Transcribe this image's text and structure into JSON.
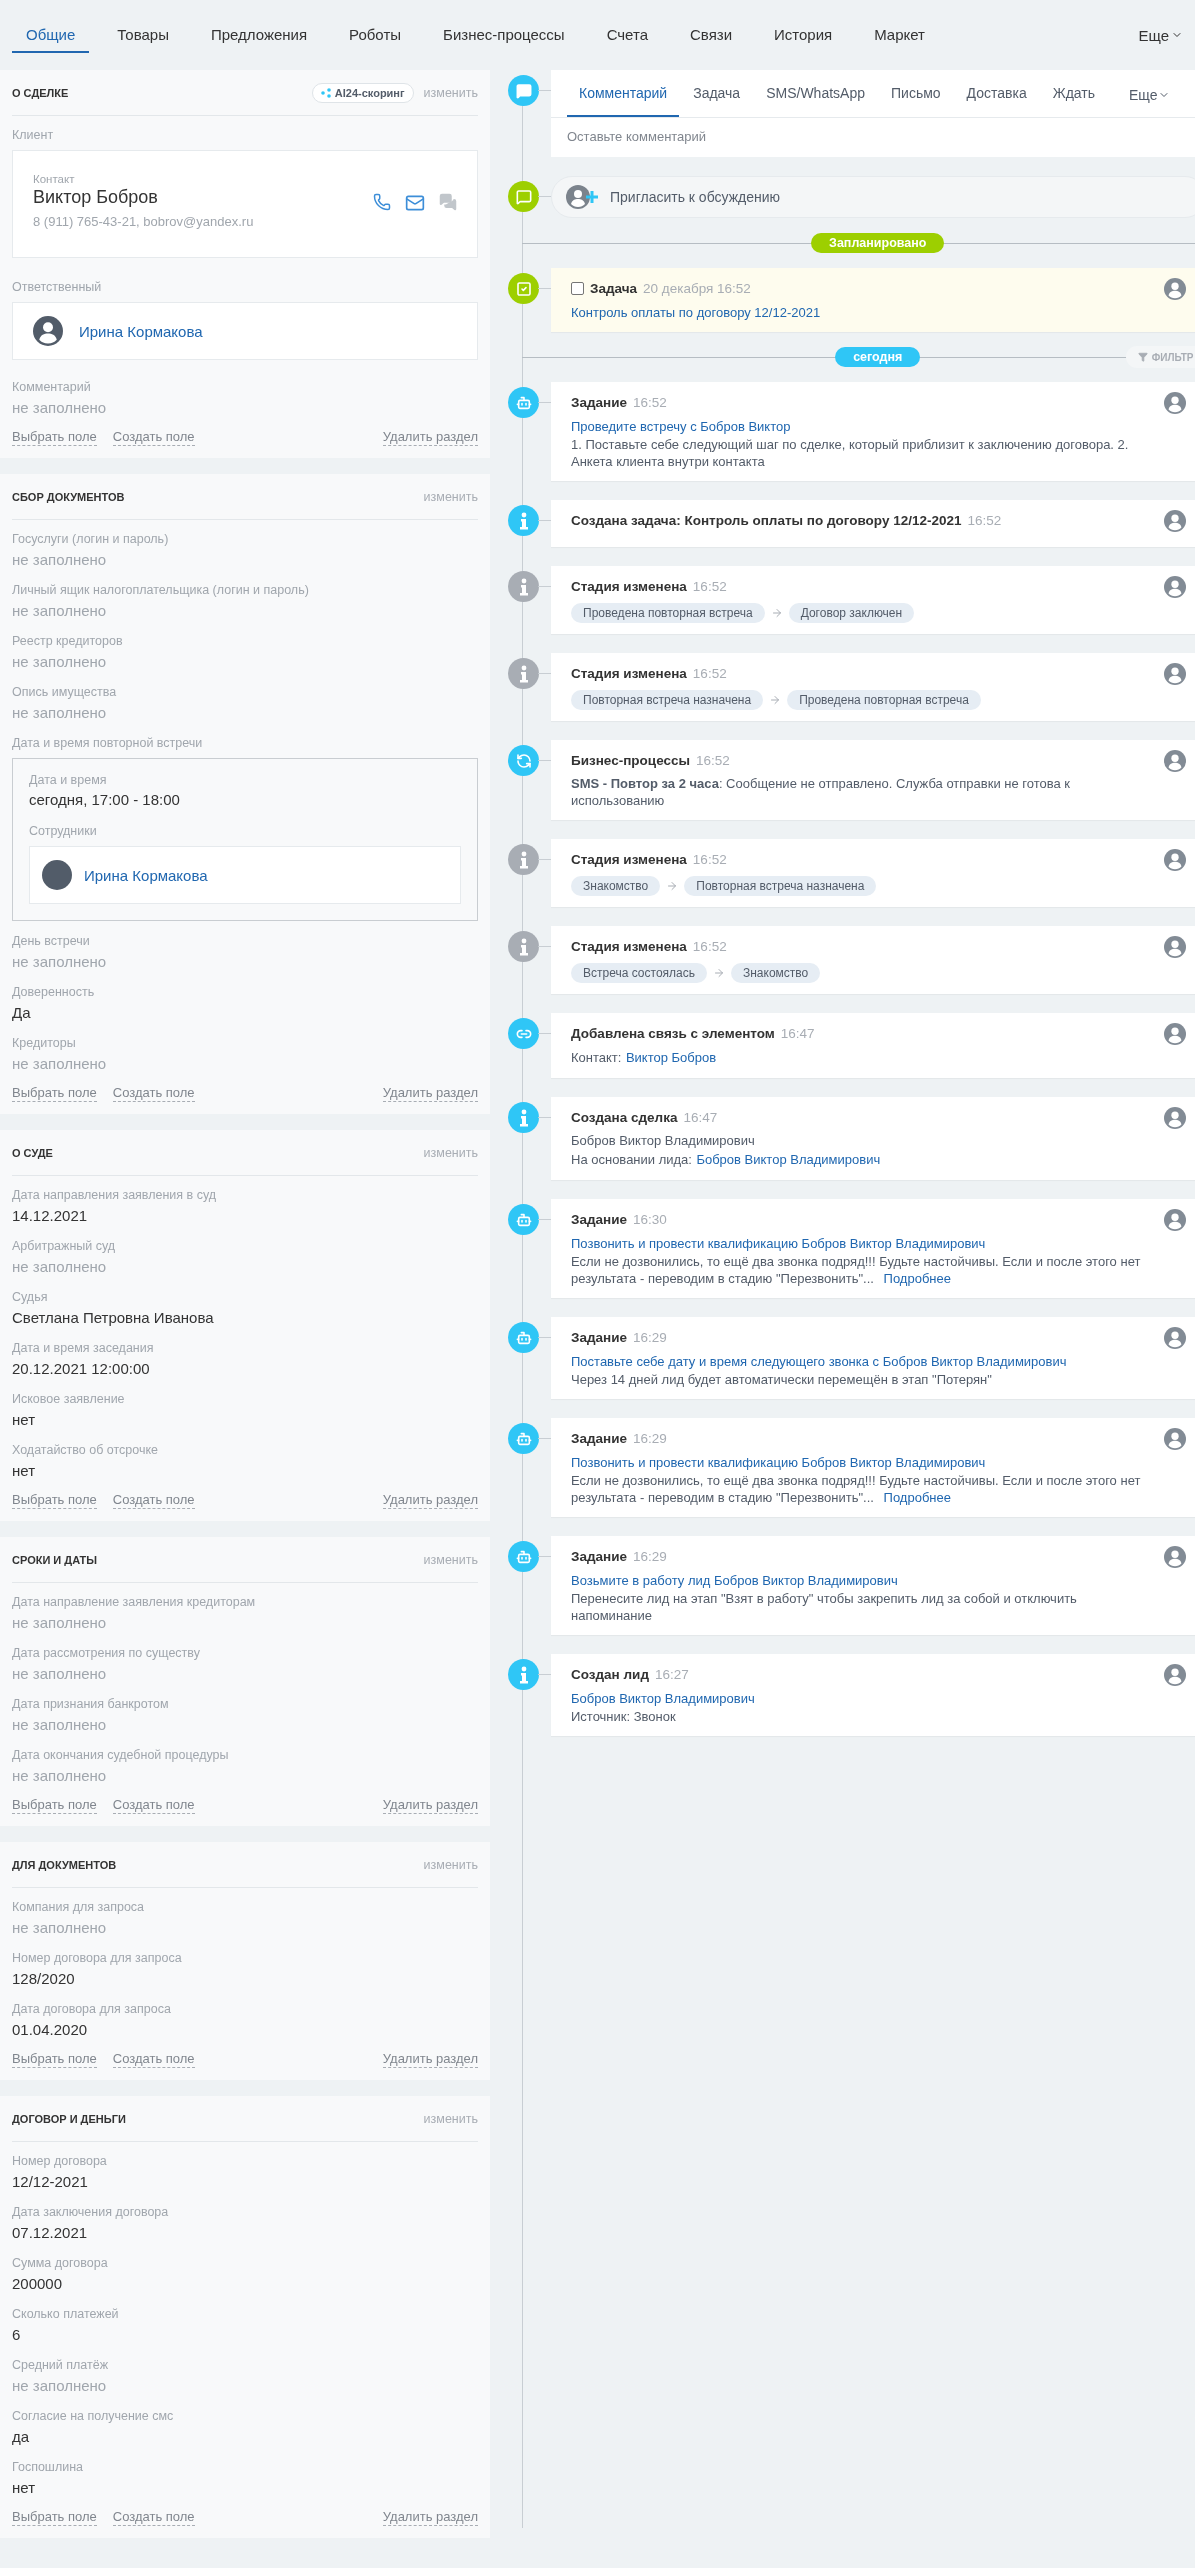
{
  "top_tabs": [
    {
      "label": "Общие",
      "selected": true
    },
    {
      "label": "Товары",
      "selected": false
    },
    {
      "label": "Предложения",
      "selected": false
    },
    {
      "label": "Роботы",
      "selected": false
    },
    {
      "label": "Бизнес-процессы",
      "selected": false
    },
    {
      "label": "Счета",
      "selected": false
    },
    {
      "label": "Связи",
      "selected": false
    },
    {
      "label": "История",
      "selected": false
    },
    {
      "label": "Маркет",
      "selected": false
    }
  ],
  "top_more": "Еще",
  "sections": [
    {
      "title": "О СДЕЛКЕ",
      "badge": "AI24-скоринг",
      "edit": "изменить",
      "fields": [
        {
          "kind": "client",
          "label": "Клиент",
          "caption": "Контакт",
          "name": "Виктор Бобров",
          "details": "8 (911) 765-43-21, bobrov@yandex.ru"
        },
        {
          "kind": "person",
          "label": "Ответственный",
          "name": "Ирина Кормакова"
        },
        {
          "kind": "text",
          "label": "Комментарий",
          "value": "не заполнено",
          "empty": true
        }
      ],
      "actions": {
        "select": "Выбрать поле",
        "create": "Создать поле",
        "remove": "Удалить раздел"
      }
    },
    {
      "title": "СБОР ДОКУМЕНТОВ",
      "edit": "изменить",
      "fields": [
        {
          "kind": "text",
          "label": "Госуслуги (логин и пароль)",
          "value": "не заполнено",
          "empty": true
        },
        {
          "kind": "text",
          "label": "Личный ящик налогоплательщика (логин и пароль)",
          "value": "не заполнено",
          "empty": true
        },
        {
          "kind": "text",
          "label": "Реестр кредиторов",
          "value": "не заполнено",
          "empty": true
        },
        {
          "kind": "text",
          "label": "Опись имущества",
          "value": "не заполнено",
          "empty": true
        },
        {
          "kind": "meeting",
          "label": "Дата и время повторной встречи",
          "date_label": "Дата и время",
          "date": "сегодня, 17:00 - 18:00",
          "staff_label": "Сотрудники",
          "staff": "Ирина Кормакова"
        },
        {
          "kind": "text",
          "label": "День встречи",
          "value": "не заполнено",
          "empty": true
        },
        {
          "kind": "text",
          "label": "Доверенность",
          "value": "Да",
          "empty": false
        },
        {
          "kind": "text",
          "label": "Кредиторы",
          "value": "не заполнено",
          "empty": true
        }
      ],
      "actions": {
        "select": "Выбрать поле",
        "create": "Создать поле",
        "remove": "Удалить раздел"
      }
    },
    {
      "title": "О СУДЕ",
      "edit": "изменить",
      "fields": [
        {
          "kind": "text",
          "label": "Дата направления заявления в суд",
          "value": "14.12.2021",
          "empty": false
        },
        {
          "kind": "text",
          "label": "Арбитражный суд",
          "value": "не заполнено",
          "empty": true
        },
        {
          "kind": "text",
          "label": "Судья",
          "value": "Светлана Петровна Иванова",
          "empty": false
        },
        {
          "kind": "text",
          "label": "Дата и время заседания",
          "value": "20.12.2021 12:00:00",
          "empty": false
        },
        {
          "kind": "text",
          "label": "Исковое заявление",
          "value": "нет",
          "empty": false
        },
        {
          "kind": "text",
          "label": "Ходатайство об отсрочке",
          "value": "нет",
          "empty": false
        }
      ],
      "actions": {
        "select": "Выбрать поле",
        "create": "Создать поле",
        "remove": "Удалить раздел"
      }
    },
    {
      "title": "СРОКИ И ДАТЫ",
      "edit": "изменить",
      "fields": [
        {
          "kind": "text",
          "label": "Дата направление заявления кредиторам",
          "value": "не заполнено",
          "empty": true
        },
        {
          "kind": "text",
          "label": "Дата рассмотрения по существу",
          "value": "не заполнено",
          "empty": true
        },
        {
          "kind": "text",
          "label": "Дата признания банкротом",
          "value": "не заполнено",
          "empty": true
        },
        {
          "kind": "text",
          "label": "Дата окончания судебной процедуры",
          "value": "не заполнено",
          "empty": true
        }
      ],
      "actions": {
        "select": "Выбрать поле",
        "create": "Создать поле",
        "remove": "Удалить раздел"
      }
    },
    {
      "title": "ДЛЯ ДОКУМЕНТОВ",
      "edit": "изменить",
      "fields": [
        {
          "kind": "text",
          "label": "Компания для запроса",
          "value": "не заполнено",
          "empty": true
        },
        {
          "kind": "text",
          "label": "Номер договора для запроса",
          "value": "128/2020",
          "empty": false
        },
        {
          "kind": "text",
          "label": "Дата договора для запроса",
          "value": "01.04.2020",
          "empty": false
        }
      ],
      "actions": {
        "select": "Выбрать поле",
        "create": "Создать поле",
        "remove": "Удалить раздел"
      }
    },
    {
      "title": "ДОГОВОР И ДЕНЬГИ",
      "edit": "изменить",
      "fields": [
        {
          "kind": "text",
          "label": "Номер договора",
          "value": "12/12-2021",
          "empty": false
        },
        {
          "kind": "text",
          "label": "Дата заключения договора",
          "value": "07.12.2021",
          "empty": false
        },
        {
          "kind": "text",
          "label": "Сумма договора",
          "value": "200000",
          "empty": false
        },
        {
          "kind": "text",
          "label": "Сколько платежей",
          "value": "6",
          "empty": false
        },
        {
          "kind": "text",
          "label": "Средний платёж",
          "value": "не заполнено",
          "empty": true
        },
        {
          "kind": "text",
          "label": "Согласие на получение смс",
          "value": "да",
          "empty": false
        },
        {
          "kind": "text",
          "label": "Госпошлина",
          "value": "нет",
          "empty": false
        }
      ],
      "actions": {
        "select": "Выбрать поле",
        "create": "Создать поле",
        "remove": "Удалить раздел"
      }
    }
  ],
  "timeline": [
    {
      "kind": "composer",
      "color": "#2fc6f6",
      "tabs": [
        {
          "label": "Комментарий",
          "selected": true
        },
        {
          "label": "Задача",
          "selected": false
        },
        {
          "label": "SMS/WhatsApp",
          "selected": false
        },
        {
          "label": "Письмо",
          "selected": false
        },
        {
          "label": "Доставка",
          "selected": false
        },
        {
          "label": "Ждать",
          "selected": false
        }
      ],
      "more": "Еще",
      "placeholder": "Оставьте комментарий"
    },
    {
      "kind": "invite",
      "color": "#9dcf00",
      "label": "Пригласить к обсуждению"
    },
    {
      "kind": "divider",
      "label": "Запланировано",
      "color": "#9dcf00"
    },
    {
      "kind": "task",
      "color": "#9dcf00",
      "checked": false,
      "title": "Задача",
      "time": "20 декабря 16:52",
      "lines": [
        {
          "kind": "link",
          "text": "Контроль оплаты по договору 12/12-2021"
        }
      ]
    },
    {
      "kind": "divider",
      "label": "сегодня",
      "color": "#2fc6f6",
      "filter": "ФИЛЬТР"
    },
    {
      "kind": "robot",
      "color": "#2fc6f6",
      "title": "Задание",
      "time": "16:52",
      "lines": [
        {
          "kind": "link",
          "text": "Проведите встречу с Бобров Виктор"
        },
        {
          "kind": "text",
          "text": "1. Поставьте себе следующий шаг по сделке, который приблизит к заключению договора. 2. Анкета клиента внутри контакта"
        }
      ]
    },
    {
      "kind": "info",
      "color": "#2fc6f6",
      "title": "Создана задача: Контроль оплаты по договору 12/12-2021",
      "time": "16:52"
    },
    {
      "kind": "info",
      "color": "#a8adb4",
      "title": "Стадия изменена",
      "time": "16:52",
      "lines": [
        {
          "kind": "stages",
          "from": "Проведена повторная встреча",
          "to": "Договор заключен"
        }
      ]
    },
    {
      "kind": "info",
      "color": "#a8adb4",
      "title": "Стадия изменена",
      "time": "16:52",
      "lines": [
        {
          "kind": "stages",
          "from": "Повторная встреча назначена",
          "to": "Проведена повторная встреча"
        }
      ]
    },
    {
      "kind": "process",
      "color": "#2fc6f6",
      "title": "Бизнес-процессы",
      "time": "16:52",
      "lines": [
        {
          "kind": "text",
          "text": "**SMS - Повтор за 2 часа**: Сообщение не отправлено. Служба отправки не готова к использованию"
        }
      ]
    },
    {
      "kind": "info",
      "color": "#a8adb4",
      "title": "Стадия изменена",
      "time": "16:52",
      "lines": [
        {
          "kind": "stages",
          "from": "Знакомство",
          "to": "Повторная встреча назначена"
        }
      ]
    },
    {
      "kind": "info",
      "color": "#a8adb4",
      "title": "Стадия изменена",
      "time": "16:52",
      "lines": [
        {
          "kind": "stages",
          "from": "Встреча состоялась",
          "to": "Знакомство"
        }
      ]
    },
    {
      "kind": "link",
      "color": "#2fc6f6",
      "title": "Добавлена связь с элементом",
      "time": "16:47",
      "lines": [
        {
          "kind": "pair",
          "label": "Контакт:",
          "link": "Виктор Бобров"
        }
      ]
    },
    {
      "kind": "info",
      "color": "#2fc6f6",
      "title": "Создана сделка",
      "time": "16:47",
      "lines": [
        {
          "kind": "text",
          "text": "Бобров Виктор Владимирович"
        },
        {
          "kind": "pair",
          "label": "На основании лида:",
          "link": "Бобров Виктор Владимирович"
        }
      ]
    },
    {
      "kind": "robot",
      "color": "#2fc6f6",
      "title": "Задание",
      "time": "16:30",
      "lines": [
        {
          "kind": "link",
          "text": "Позвонить и провести квалификацию Бобров Виктор Владимирович"
        },
        {
          "kind": "more",
          "text": "Если не дозвонились, то ещё два звонка подряд!!! Будьте настойчивы. Если и после этого нет результата - переводим в стадию \"Перезвонить\"...",
          "link": "Подробнее"
        }
      ]
    },
    {
      "kind": "robot",
      "color": "#2fc6f6",
      "title": "Задание",
      "time": "16:29",
      "lines": [
        {
          "kind": "link",
          "text": "Поставьте себе дату и время следующего звонка с Бобров Виктор Владимирович"
        },
        {
          "kind": "text",
          "text": "Через 14 дней лид будет автоматически перемещён в этап \"Потерян\""
        }
      ]
    },
    {
      "kind": "robot",
      "color": "#2fc6f6",
      "title": "Задание",
      "time": "16:29",
      "lines": [
        {
          "kind": "link",
          "text": "Позвонить и провести квалификацию Бобров Виктор Владимирович"
        },
        {
          "kind": "more",
          "text": "Если не дозвонились, то ещё два звонка подряд!!! Будьте настойчивы. Если и после этого нет результата - переводим в стадию \"Перезвонить\"...",
          "link": "Подробнее"
        }
      ]
    },
    {
      "kind": "robot",
      "color": "#2fc6f6",
      "title": "Задание",
      "time": "16:29",
      "lines": [
        {
          "kind": "link",
          "text": "Возьмите в работу лид Бобров Виктор Владимирович"
        },
        {
          "kind": "text",
          "text": "Перенесите лид на этап \"Взят в работу\" чтобы закрепить лид за собой и отключить напоминание"
        }
      ]
    },
    {
      "kind": "info",
      "color": "#2fc6f6",
      "title": "Создан лид",
      "time": "16:27",
      "lines": [
        {
          "kind": "link",
          "text": "Бобров Виктор Владимирович"
        },
        {
          "kind": "text",
          "text": "Источник: Звонок"
        }
      ]
    }
  ]
}
